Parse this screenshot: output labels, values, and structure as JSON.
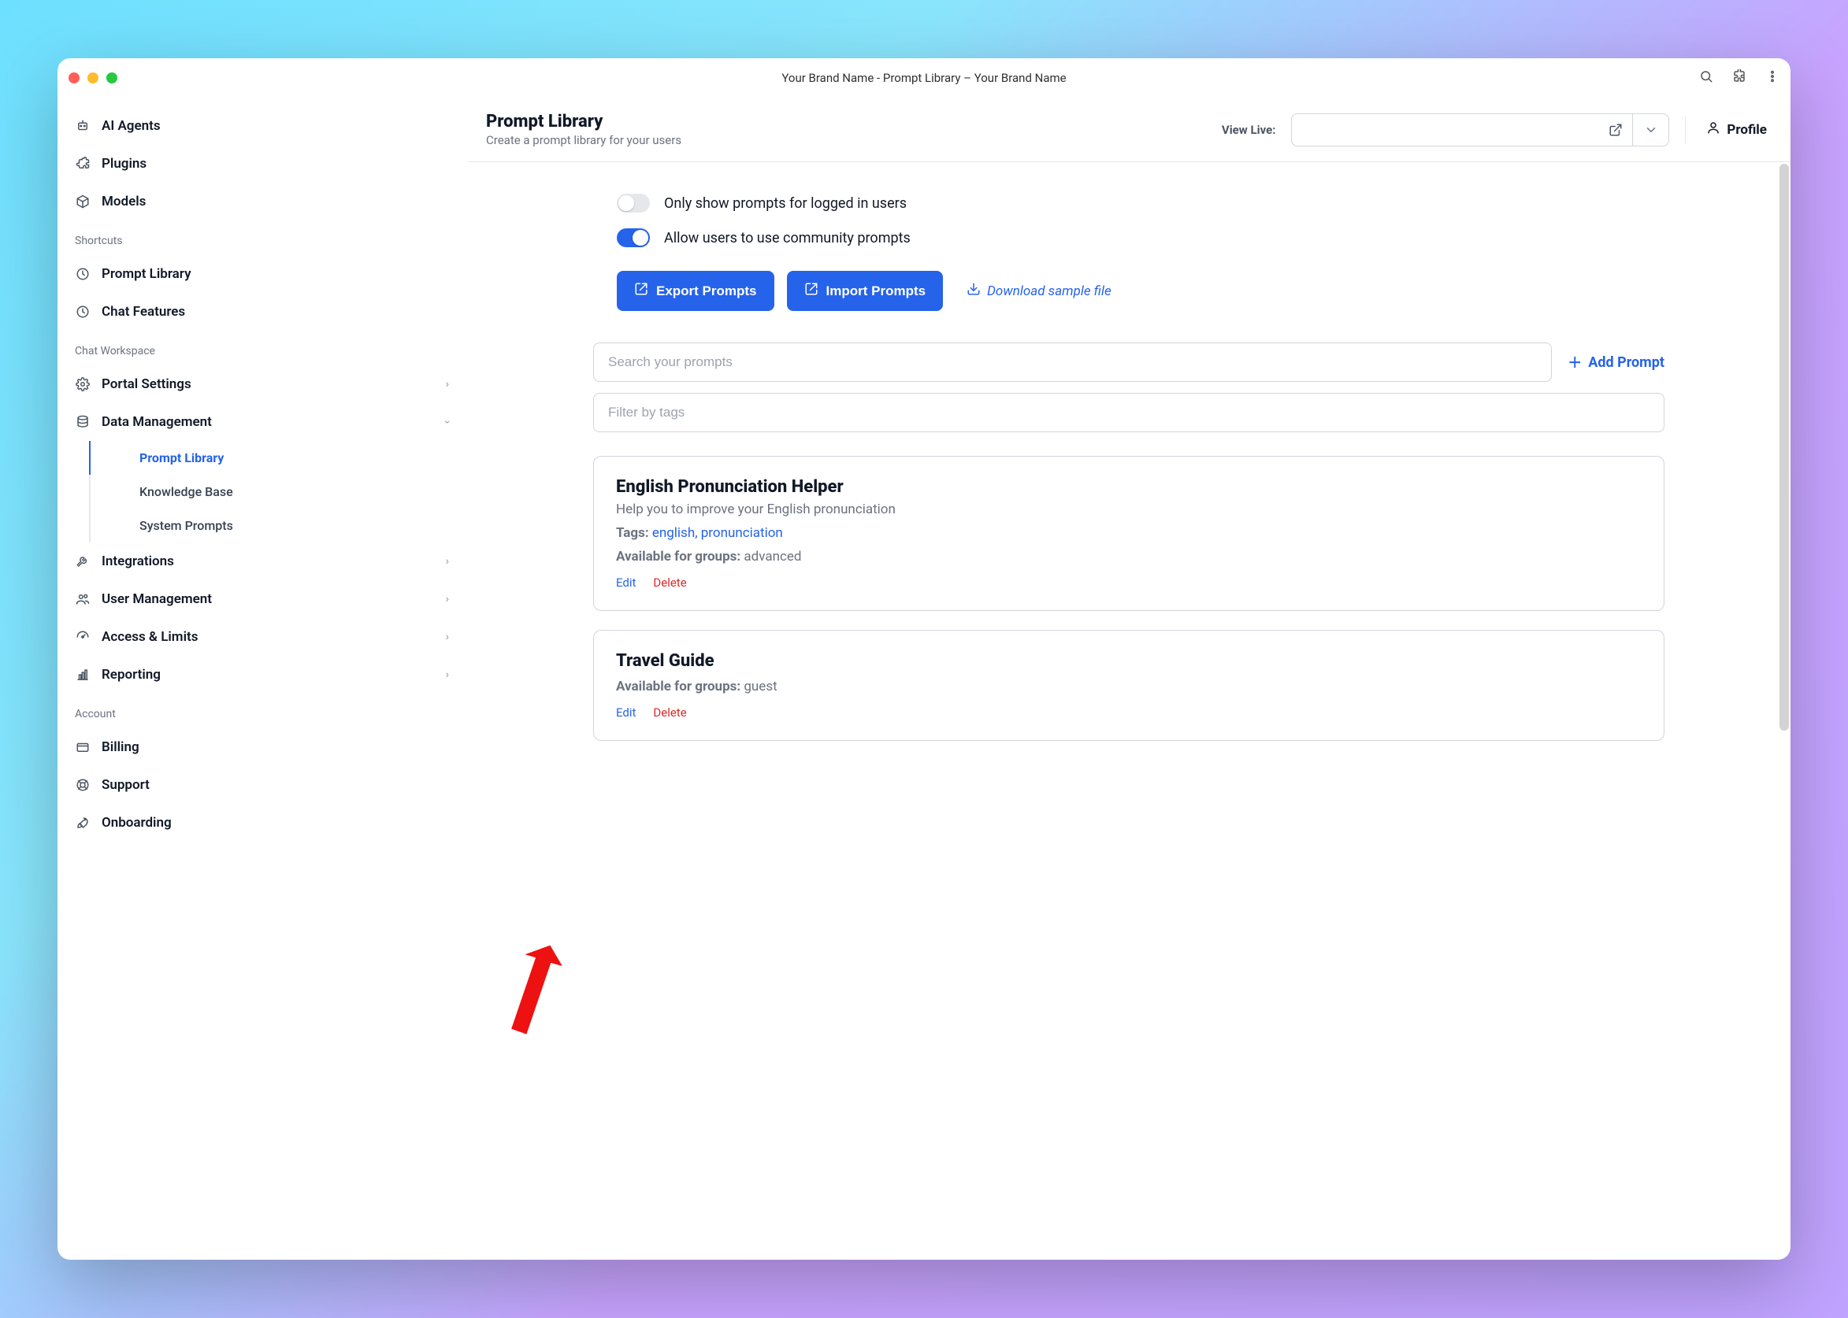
{
  "window_title": "Your Brand Name - Prompt Library – Your Brand Name",
  "sidebar": {
    "top_items": [
      {
        "label": "AI Agents"
      },
      {
        "label": "Plugins"
      },
      {
        "label": "Models"
      }
    ],
    "shortcuts_header": "Shortcuts",
    "shortcuts": [
      {
        "label": "Prompt Library"
      },
      {
        "label": "Chat Features"
      }
    ],
    "workspace_header": "Chat Workspace",
    "workspace": [
      {
        "label": "Portal Settings"
      },
      {
        "label": "Data Management"
      }
    ],
    "data_mgmt_children": [
      {
        "label": "Prompt Library"
      },
      {
        "label": "Knowledge Base"
      },
      {
        "label": "System Prompts"
      }
    ],
    "workspace_rest": [
      {
        "label": "Integrations"
      },
      {
        "label": "User Management"
      },
      {
        "label": "Access & Limits"
      },
      {
        "label": "Reporting"
      }
    ],
    "account_header": "Account",
    "account": [
      {
        "label": "Billing"
      },
      {
        "label": "Support"
      },
      {
        "label": "Onboarding"
      }
    ]
  },
  "header": {
    "title": "Prompt Library",
    "subtitle": "Create a prompt library for your users",
    "view_live_label": "View Live:",
    "profile_label": "Profile"
  },
  "toggles": {
    "logged_in": "Only show prompts for logged in users",
    "community": "Allow users to use community prompts"
  },
  "buttons": {
    "export": "Export Prompts",
    "import": "Import Prompts",
    "download": "Download sample file"
  },
  "search": {
    "placeholder": "Search your prompts",
    "filter_placeholder": "Filter by tags",
    "add_prompt": "Add Prompt"
  },
  "labels": {
    "tags": "Tags:",
    "groups": "Available for groups:",
    "edit": "Edit",
    "delete": "Delete"
  },
  "prompts": [
    {
      "title": "English Pronunciation Helper",
      "desc": "Help you to improve your English pronunciation",
      "tags": "english, pronunciation",
      "groups": "advanced"
    },
    {
      "title": "Travel Guide",
      "desc": "",
      "tags": "",
      "groups": "guest"
    }
  ]
}
